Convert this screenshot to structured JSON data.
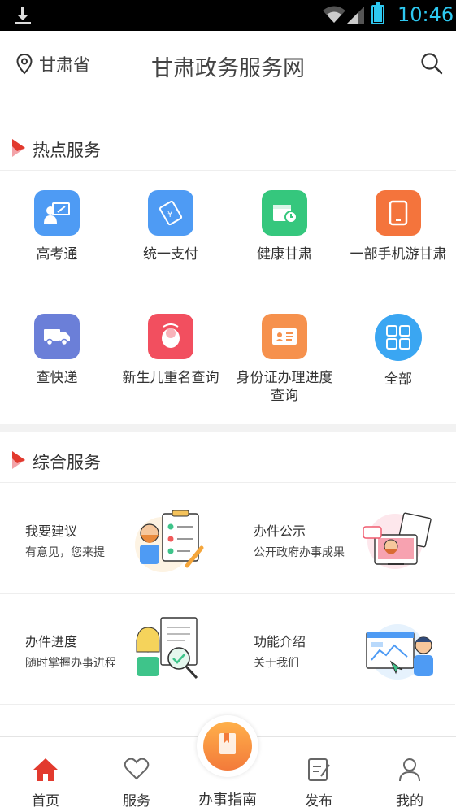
{
  "status_bar": {
    "time": "10:46"
  },
  "header": {
    "location": "甘肃省",
    "title": "甘肃政务服务网"
  },
  "hot_section": {
    "title": "热点服务"
  },
  "hot_services": [
    {
      "label": "高考通",
      "icon": "student-board-icon",
      "color": "#4e9bf4"
    },
    {
      "label": "统一支付",
      "icon": "payment-card-icon",
      "color": "#4e9bf4"
    },
    {
      "label": "健康甘肃",
      "icon": "calendar-clock-icon",
      "color": "#35c77d"
    },
    {
      "label": "一部手机游甘肃",
      "icon": "tablet-icon",
      "color": "#f4743c"
    },
    {
      "label": "查快递",
      "icon": "truck-icon",
      "color": "#6b7fd8"
    },
    {
      "label": "新生儿重名查询",
      "icon": "baby-icon",
      "color": "#f24f5f"
    },
    {
      "label": "身份证办理进度查询",
      "icon": "id-card-icon",
      "color": "#f6914d"
    },
    {
      "label": "全部",
      "icon": "grid-all-icon",
      "color": "#3aa6f2"
    }
  ],
  "general_section": {
    "title": "综合服务"
  },
  "general_services": [
    {
      "title": "我要建议",
      "desc": "有意见，您来提"
    },
    {
      "title": "办件公示",
      "desc": "公开政府办事成果"
    },
    {
      "title": "办件进度",
      "desc": "随时掌握办事进程"
    },
    {
      "title": "功能介绍",
      "desc": "关于我们"
    }
  ],
  "tabbar": {
    "tabs": [
      {
        "label": "首页",
        "icon": "home-icon",
        "active": true
      },
      {
        "label": "服务",
        "icon": "heart-icon"
      },
      {
        "label": "办事指南",
        "icon": "guide-book-icon"
      },
      {
        "label": "发布",
        "icon": "edit-doc-icon"
      },
      {
        "label": "我的",
        "icon": "user-icon"
      }
    ],
    "active_color": "#e23a2e"
  }
}
